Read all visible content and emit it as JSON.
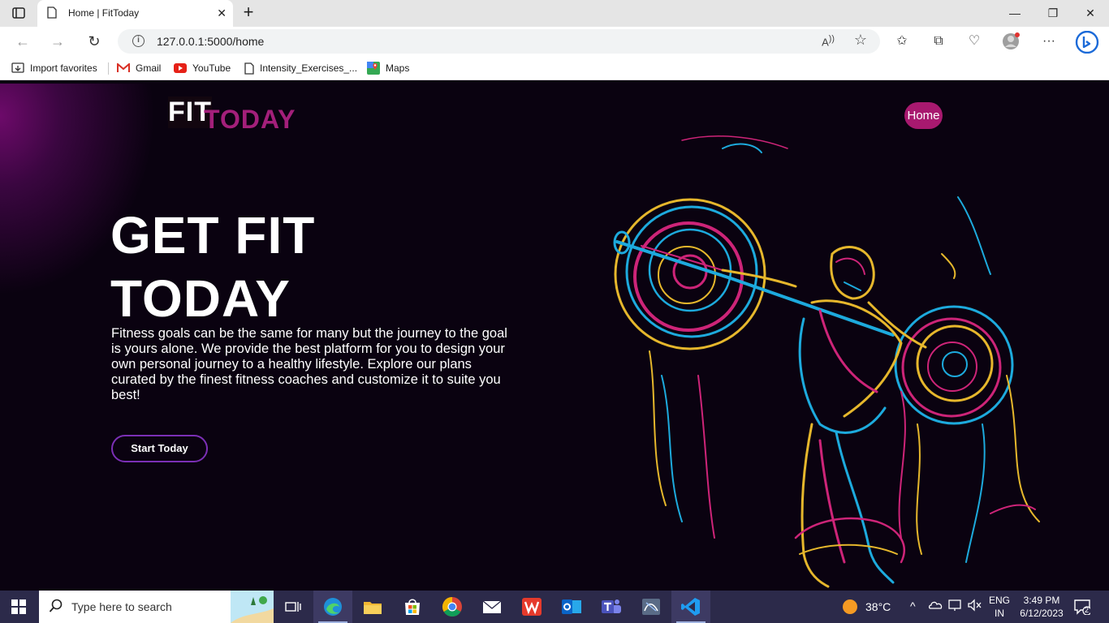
{
  "browser": {
    "tab_title": "Home | FitToday",
    "url": "127.0.0.1:5000/home",
    "bookmarks": [
      "Import favorites",
      "Gmail",
      "YouTube",
      "Intensity_Exercises_...",
      "Maps"
    ]
  },
  "site": {
    "logo_primary": "FIT",
    "logo_secondary": "TODAY",
    "nav_home": "Home",
    "hero_line1": "GET FIT",
    "hero_line2": "TODAY",
    "hero_paragraph": "Fitness goals can be the same for many but the journey to the goal is yours alone. We provide the best platform for you to design your own personal journey to a healthy lifestyle. Explore our plans curated by the finest fitness coaches and customize it to suite you best!",
    "cta_label": "Start Today",
    "accent_color": "#a8196f",
    "button_border_color": "#7b2fb5"
  },
  "taskbar": {
    "search_placeholder": "Type here to search",
    "weather": "38°C",
    "language_line1": "ENG",
    "language_line2": "IN",
    "time": "3:49 PM",
    "date": "6/12/2023",
    "notification_count": "2"
  }
}
